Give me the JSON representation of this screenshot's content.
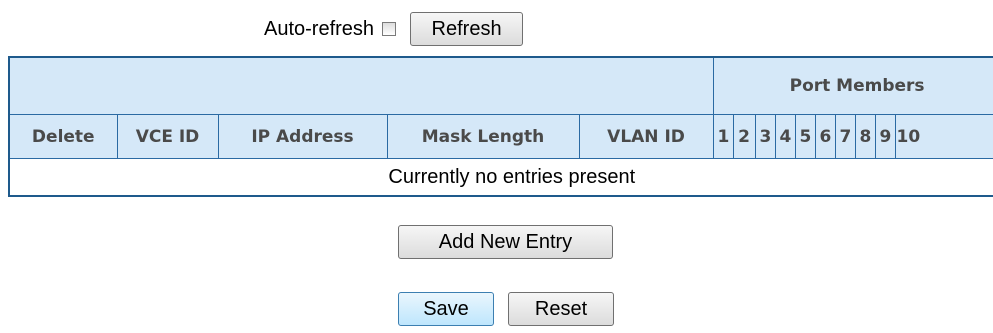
{
  "toolbar": {
    "auto_refresh_label": "Auto-refresh",
    "auto_refresh_checked": false,
    "refresh_label": "Refresh"
  },
  "table": {
    "group_header": "Port Members",
    "columns": [
      "Delete",
      "VCE ID",
      "IP Address",
      "Mask Length",
      "VLAN ID"
    ],
    "ports": [
      "1",
      "2",
      "3",
      "4",
      "5",
      "6",
      "7",
      "8",
      "9",
      "10"
    ],
    "empty_message": "Currently no entries present"
  },
  "actions": {
    "add_label": "Add New Entry",
    "save_label": "Save",
    "reset_label": "Reset"
  },
  "colors": {
    "header_bg": "#d5e8f8",
    "border": "#1e5a8c",
    "header_text": "#4a4a4a"
  }
}
